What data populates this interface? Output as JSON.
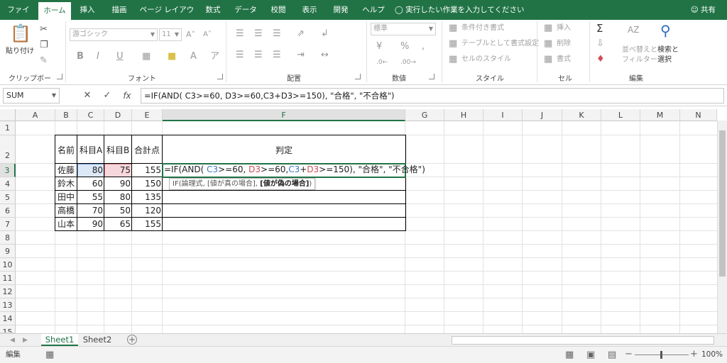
{
  "tabs": [
    "ファイル",
    "ホーム",
    "挿入",
    "描画",
    "ページ レイアウト",
    "数式",
    "データ",
    "校閲",
    "表示",
    "開発",
    "ヘルプ"
  ],
  "active_tab": "ホーム",
  "tell_me": "実行したい作業を入力してください",
  "share": "共有",
  "ribbon": {
    "clipboard": {
      "label": "クリップボード",
      "paste": "貼り付け"
    },
    "font": {
      "label": "フォント",
      "name": "游ゴシック",
      "size": "11"
    },
    "alignment": {
      "label": "配置"
    },
    "number": {
      "label": "数値",
      "format": "標準"
    },
    "styles": {
      "label": "スタイル",
      "conditional": "条件付き書式",
      "as_table": "テーブルとして書式設定",
      "cell_styles": "セルのスタイル"
    },
    "cells": {
      "label": "セル",
      "insert": "挿入",
      "delete": "削除",
      "format": "書式"
    },
    "editing": {
      "label": "編集",
      "sort_filter_1": "並べ替えと",
      "sort_filter_2": "フィルター",
      "find_select_1": "検索と",
      "find_select_2": "選択"
    }
  },
  "name_box": "SUM",
  "formula_bar": "=IF(AND( C3>=60, D3>=60,C3+D3>=150), \"合格\", \"不合格\")",
  "columns": [
    "A",
    "B",
    "C",
    "D",
    "E",
    "F",
    "G",
    "H",
    "I",
    "J",
    "K",
    "L",
    "M",
    "N"
  ],
  "rows": [
    "1",
    "2",
    "3",
    "4",
    "5",
    "6",
    "7",
    "8",
    "9",
    "10",
    "11",
    "12",
    "13",
    "14",
    "15"
  ],
  "table": {
    "headers": [
      "名前",
      "科目A",
      "科目B",
      "合計点",
      "判定"
    ],
    "rows": [
      [
        "佐藤",
        "80",
        "75",
        "155"
      ],
      [
        "鈴木",
        "60",
        "90",
        "150"
      ],
      [
        "田中",
        "55",
        "80",
        "135"
      ],
      [
        "高橋",
        "70",
        "50",
        "120"
      ],
      [
        "山本",
        "90",
        "65",
        "155"
      ]
    ]
  },
  "editing_formula": {
    "p1": "=IF(AND( ",
    "ref1": "C3",
    "p2": ">=60, ",
    "ref2": "D3",
    "p3": ">=60,",
    "ref3": "C3",
    "p4": "+",
    "ref4": "D3",
    "p5": ">=150), \"合格\", \"不合格\")"
  },
  "tooltip": {
    "text": "IF(論理式, [値が真の場合], ",
    "bold": "[値が偽の場合]",
    "end": ")"
  },
  "sheets": [
    "Sheet1",
    "Sheet2"
  ],
  "active_sheet": "Sheet1",
  "status_mode": "編集",
  "zoom": "100%",
  "colors": {
    "excel_green": "#217346",
    "ref_blue": "#3a78c8",
    "ref_red": "#d44a56"
  }
}
